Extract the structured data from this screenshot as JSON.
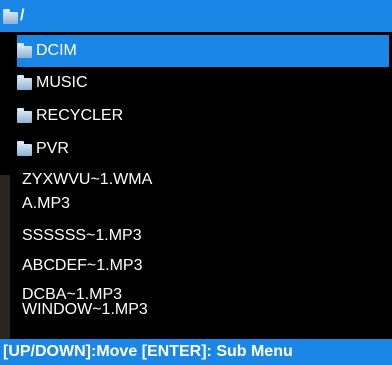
{
  "header": {
    "icon": "folder-icon",
    "path": "/"
  },
  "entries": [
    {
      "name": "DCIM",
      "type": "folder",
      "selected": true
    },
    {
      "name": "MUSIC",
      "type": "folder"
    },
    {
      "name": "RECYCLER",
      "type": "folder"
    },
    {
      "name": "PVR",
      "type": "folder"
    },
    {
      "name": "ZYXWVU~1.WMA",
      "type": "file"
    },
    {
      "name": "A.MP3",
      "type": "file"
    },
    {
      "name": "SSSSSS~1.MP3",
      "type": "file"
    },
    {
      "name": "ABCDEF~1.MP3",
      "type": "file"
    },
    {
      "name": "DCBA~1.MP3",
      "type": "file"
    },
    {
      "name": "WINDOW~1.MP3",
      "type": "file"
    }
  ],
  "footer": {
    "hint": "[UP/DOWN]:Move [ENTER]: Sub Menu"
  },
  "colors": {
    "accent": "#1a87e6",
    "background": "#000000",
    "text": "#ffffff"
  }
}
